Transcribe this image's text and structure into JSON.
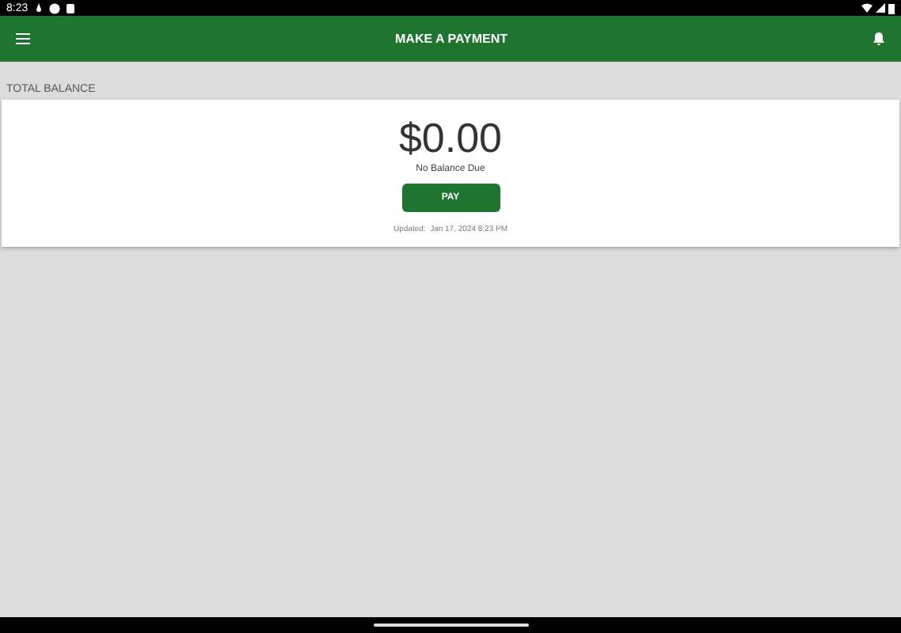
{
  "status_bar": {
    "time": "8:23"
  },
  "app_bar": {
    "title": "MAKE A PAYMENT"
  },
  "balance": {
    "section_label": "TOTAL BALANCE",
    "amount": "$0.00",
    "status": "No Balance Due",
    "button": "PAY",
    "updated": "Updated:  Jan 17, 2024 8:23 PM"
  }
}
